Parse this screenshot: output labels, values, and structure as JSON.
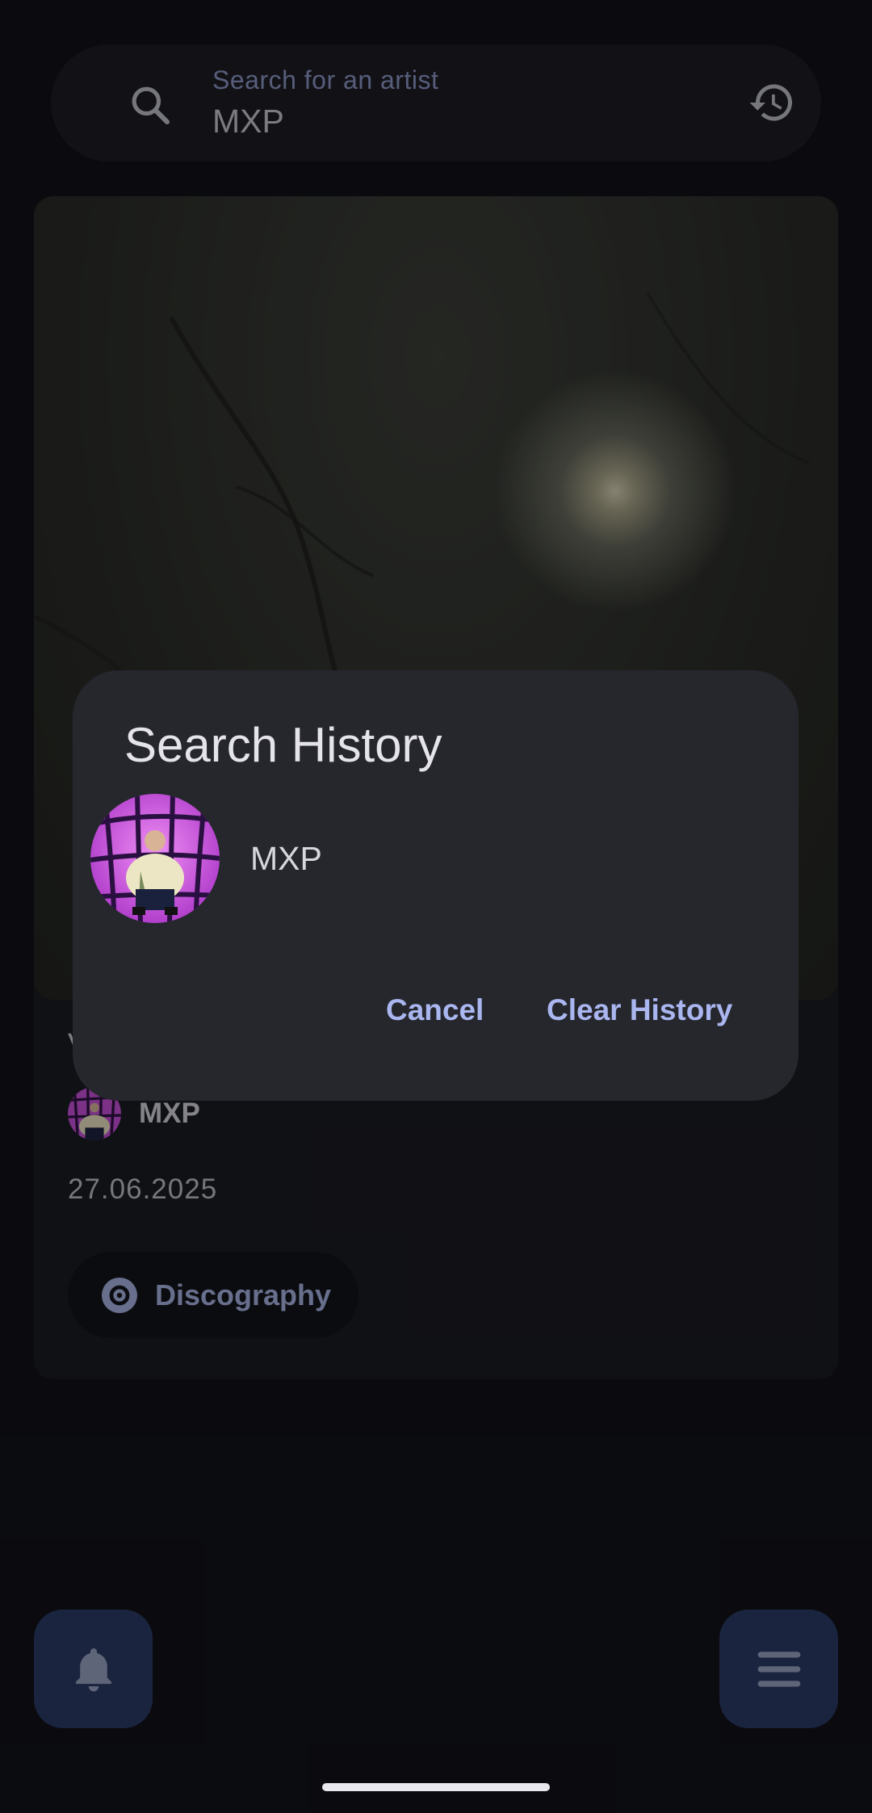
{
  "search": {
    "placeholder": "Search for an artist",
    "value": "MXP",
    "search_icon": "search-icon",
    "history_icon": "history-icon"
  },
  "card": {
    "partial_title": "V",
    "artist": "MXP",
    "date": "27.06.2025",
    "discography_label": "Discography"
  },
  "dialog": {
    "title": "Search History",
    "items": [
      {
        "label": "MXP"
      }
    ],
    "cancel_label": "Cancel",
    "clear_label": "Clear History"
  },
  "fabs": {
    "left_icon": "bell-icon",
    "right_icon": "menu-icon"
  },
  "colors": {
    "background": "#121319",
    "accent": "#aab6ef",
    "fab": "#2b3a67"
  }
}
